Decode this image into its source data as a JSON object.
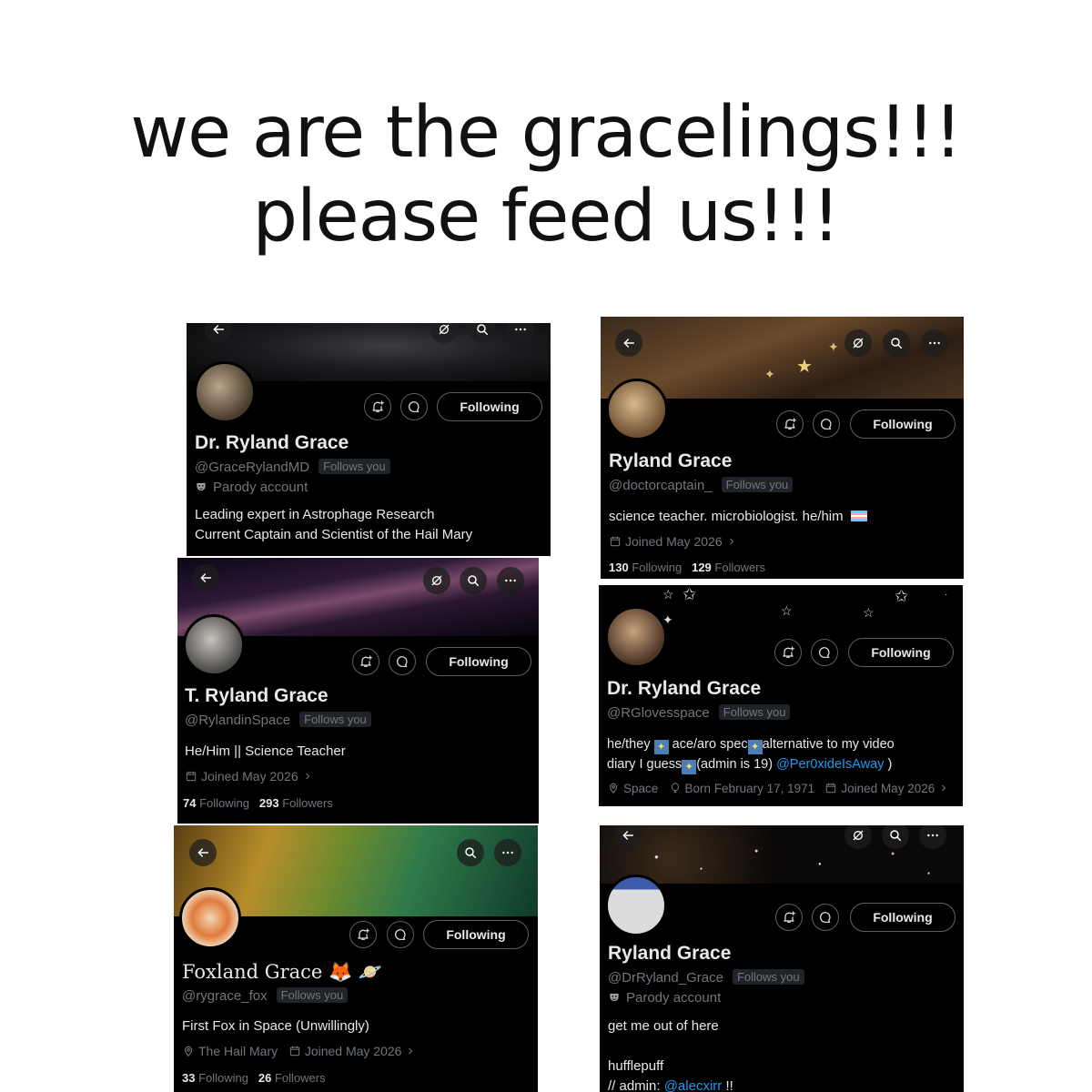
{
  "headline": {
    "line1": "we are the gracelings!!!",
    "line2": "please feed us!!!"
  },
  "common": {
    "following_label": "Following",
    "follows_you_label": "Follows you",
    "parody_label": "Parody account",
    "stats_following_word": "Following",
    "stats_followers_word": "Followers",
    "joined": "Joined May 2026"
  },
  "cards": [
    {
      "name": "Dr. Ryland Grace",
      "handle": "@GraceRylandMD",
      "bio_line1": "Leading expert in Astrophage Research",
      "bio_line2": "Current Captain and Scientist of the Hail Mary"
    },
    {
      "name": "Ryland Grace",
      "handle": "@doctorcaptain_",
      "bio": "science teacher. microbiologist. he/him",
      "following_count": "130",
      "followers_count": "129"
    },
    {
      "name": "T. Ryland Grace",
      "handle": "@RylandinSpace",
      "bio": "He/Him || Science Teacher",
      "following_count": "74",
      "followers_count": "293"
    },
    {
      "name": "Dr. Ryland Grace",
      "handle": "@RGlovesspace",
      "bio_l1_a": "he/they",
      "bio_l1_b": "ace/aro spec",
      "bio_l1_c": "alternative to my video",
      "bio_l2_a": "diary I guess",
      "bio_l2_b": "(admin is 19)",
      "bio_l2_mention": "@Per0xideIsAway",
      "bio_l2_end": ")",
      "location": "Space",
      "born": "Born February 17, 1971"
    },
    {
      "name": "Foxland Grace",
      "handle": "@rygrace_fox",
      "bio": "First Fox in Space (Unwillingly)",
      "location": "The Hail Mary",
      "following_count": "33",
      "followers_count": "26"
    },
    {
      "name": "Ryland Grace",
      "handle": "@DrRyland_Grace",
      "bio_line1": "get me out of here",
      "bio_line2": "hufflepuff",
      "bio_admin_prefix": "// admin:",
      "bio_admin_mention": "@alecxirr",
      "bio_admin_suffix": "!!"
    }
  ],
  "colors": {
    "card_bg": "#000000",
    "text_primary": "#e7e9ea",
    "text_secondary": "#71767b",
    "link": "#1d9bf0",
    "badge_bg": "#202327"
  }
}
